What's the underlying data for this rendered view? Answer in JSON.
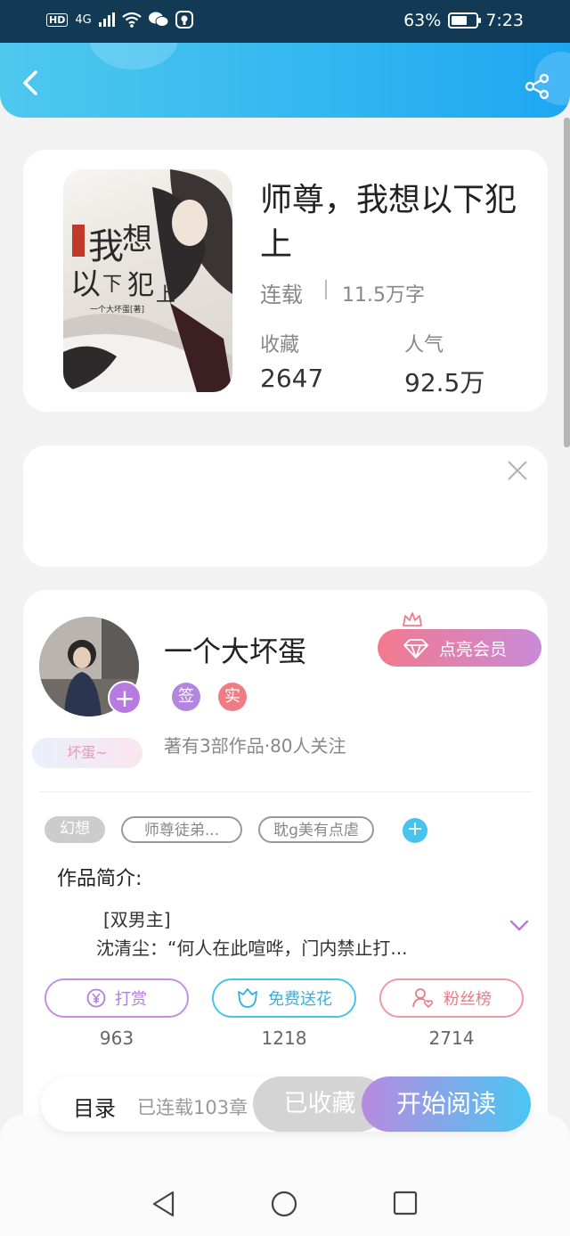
{
  "status_bar": {
    "network": "HD",
    "signal": "4G",
    "battery": "63%",
    "battery_level": 0.63,
    "time": "7:23"
  },
  "header": {
    "back_icon": "chevron-left-icon",
    "share_icon": "share-icon"
  },
  "book": {
    "title": "师尊，我想以下犯上",
    "status": "连载",
    "word_count": "11.5万字",
    "favorites_label": "收藏",
    "favorites_value": "2647",
    "popularity_label": "人气",
    "popularity_value": "92.5万",
    "cover_author": "一个大坏蛋[著]"
  },
  "ad_panel": {
    "close_icon": "close-icon"
  },
  "author": {
    "name": "一个大坏蛋",
    "vip_button": "点亮会员",
    "badge_signed": "签",
    "badge_verified": "实",
    "meta": "著有3部作品·80人关注",
    "nickname_tag": "坏蛋~"
  },
  "tags": {
    "items": [
      "幻想",
      "师尊徒弟...",
      "耽g美有点虐"
    ]
  },
  "intro": {
    "label": "作品简介:",
    "line1": "[双男主]",
    "line2": "沈清尘：“何人在此喧哗，门内禁止打..."
  },
  "actions": {
    "reward_label": "打赏",
    "reward_count": "963",
    "flower_label": "免费送花",
    "flower_count": "1218",
    "fans_label": "粉丝榜",
    "fans_count": "2714"
  },
  "bottom_bar": {
    "toc_label": "目录",
    "toc_count": "已连载103章",
    "favorited_button": "已收藏",
    "read_button": "开始阅读"
  },
  "colors": {
    "header_accent": "#31b6f0",
    "purple_accent": "#b57be0",
    "pink_accent": "#f07b82"
  }
}
